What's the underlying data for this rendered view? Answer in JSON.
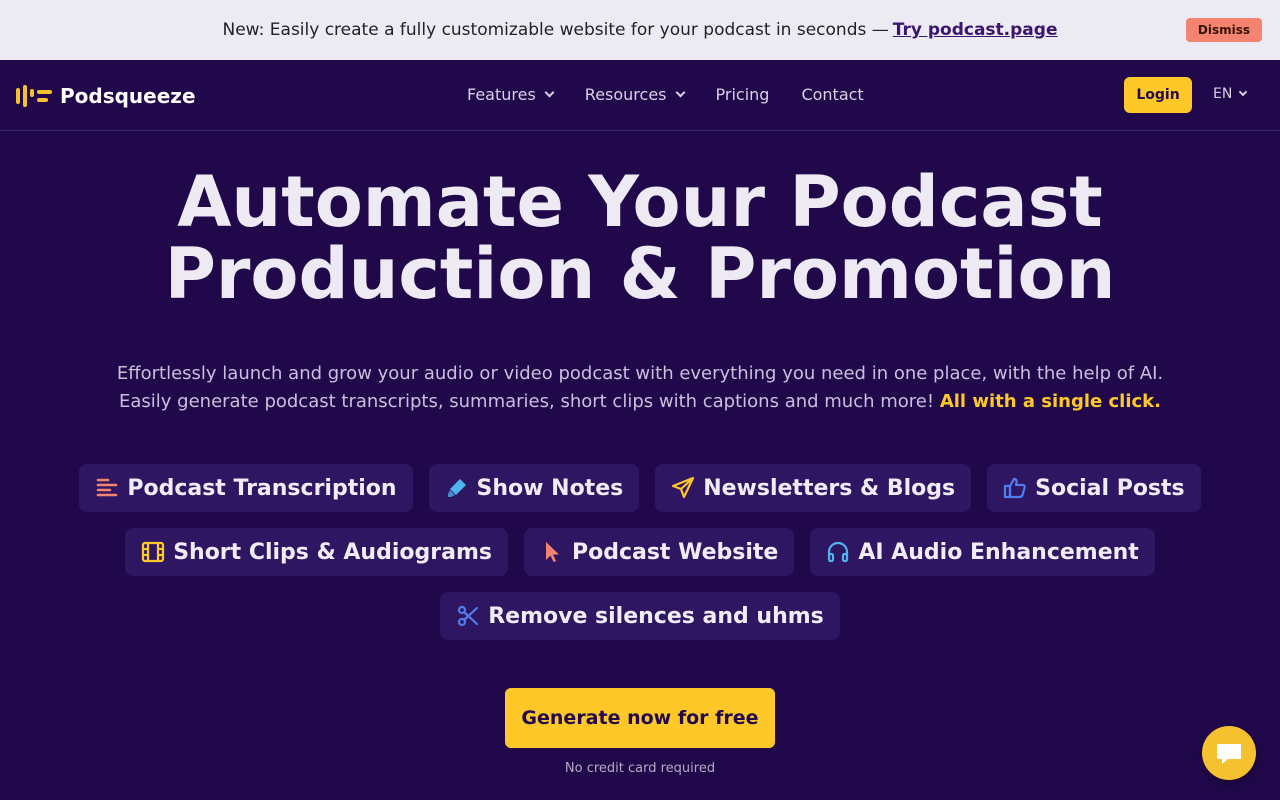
{
  "banner": {
    "text": "New: Easily create a fully customizable website for your podcast in seconds —",
    "link": "Try podcast.page",
    "dismiss": "Dismiss"
  },
  "nav": {
    "brand": "Podsqueeze",
    "links": [
      "Features",
      "Resources",
      "Pricing",
      "Contact"
    ],
    "login": "Login",
    "language": "EN"
  },
  "hero": {
    "title_line1": "Automate Your Podcast",
    "title_line2": "Production & Promotion",
    "subtitle_line1": "Effortlessly launch and grow your audio or video podcast with everything you need in one place, with the help of AI.",
    "subtitle_line2": "Easily generate podcast transcripts, summaries, short clips with captions and much more!",
    "subtitle_highlight": "All with a single click."
  },
  "features": [
    {
      "label": "Podcast Transcription",
      "icon": "lines-icon",
      "color": "#f4846f"
    },
    {
      "label": "Show Notes",
      "icon": "highlighter-icon",
      "color": "#4fb3ec"
    },
    {
      "label": "Newsletters & Blogs",
      "icon": "paper-plane-icon",
      "color": "#fdc828"
    },
    {
      "label": "Social Posts",
      "icon": "thumbs-up-icon",
      "color": "#4f7ef0"
    },
    {
      "label": "Short Clips & Audiograms",
      "icon": "film-icon",
      "color": "#fdc828"
    },
    {
      "label": "Podcast Website",
      "icon": "cursor-icon",
      "color": "#f4846f"
    },
    {
      "label": "AI Audio Enhancement",
      "icon": "headphones-icon",
      "color": "#4fb3ec"
    },
    {
      "label": "Remove silences and uhms",
      "icon": "scissors-icon",
      "color": "#4f7ef0"
    }
  ],
  "cta": {
    "button": "Generate now for free",
    "note": "No credit card required"
  },
  "colors": {
    "background": "#21084b",
    "accent": "#fdc828",
    "pill": "#2f1663",
    "banner": "#ecebf3"
  }
}
